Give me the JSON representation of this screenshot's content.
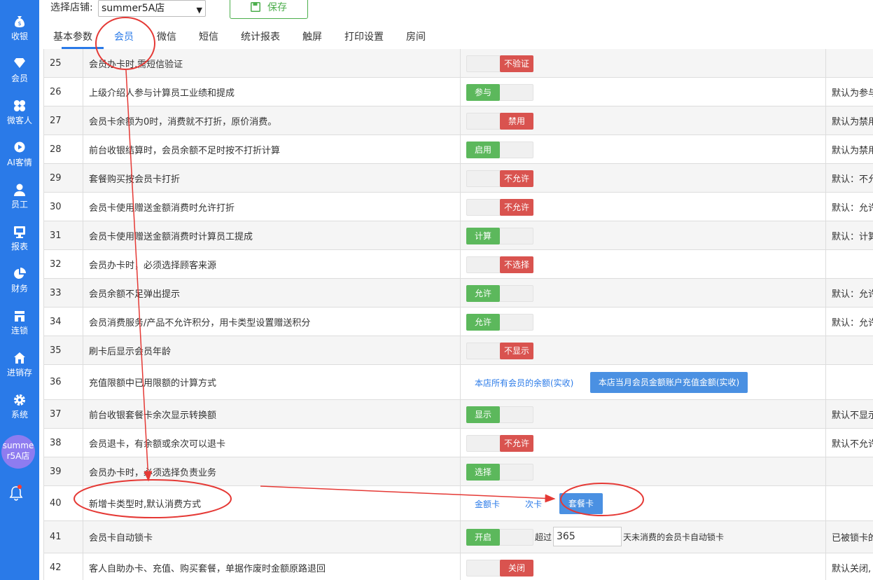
{
  "sidebar": {
    "items": [
      {
        "label": "收银",
        "icon": "money-bag-icon"
      },
      {
        "label": "会员",
        "icon": "diamond-icon"
      },
      {
        "label": "微客人",
        "icon": "clover-icon"
      },
      {
        "label": "AI客情",
        "icon": "play-circle-icon"
      },
      {
        "label": "员工",
        "icon": "user-icon"
      },
      {
        "label": "报表",
        "icon": "monitor-icon"
      },
      {
        "label": "财务",
        "icon": "pie-chart-icon"
      },
      {
        "label": "连锁",
        "icon": "store-icon"
      },
      {
        "label": "进销存",
        "icon": "home-icon"
      },
      {
        "label": "系统",
        "icon": "gear-icon"
      }
    ],
    "store_avatar": "summer5A店",
    "bell_icon": "bell-icon"
  },
  "header": {
    "store_label": "选择店铺:",
    "store_value": "summer5A店",
    "save_label": "保存",
    "tabs": [
      "基本参数",
      "会员",
      "微信",
      "短信",
      "统计报表",
      "触屏",
      "打印设置",
      "房间"
    ],
    "active_tab": "会员"
  },
  "rows": [
    {
      "num": "25",
      "desc": "会员办卡时,需短信验证",
      "type": "toggle",
      "on": false,
      "label": "不验证",
      "note": ""
    },
    {
      "num": "26",
      "desc": "上级介绍人参与计算员工业绩和提成",
      "type": "toggle",
      "on": true,
      "label": "参与",
      "note": "默认为参与"
    },
    {
      "num": "27",
      "desc": "会员卡余额为0时，消费就不打折，原价消费。",
      "type": "toggle",
      "on": false,
      "label": "禁用",
      "note": "默认为禁用"
    },
    {
      "num": "28",
      "desc": "前台收银结算时，会员余额不足时按不打折计算",
      "type": "toggle",
      "on": true,
      "label": "启用",
      "note": "默认为禁用"
    },
    {
      "num": "29",
      "desc": "套餐购买按会员卡打折",
      "type": "toggle",
      "on": false,
      "label": "不允许",
      "note": "默认：不允"
    },
    {
      "num": "30",
      "desc": "会员卡使用赠送金额消费时允许打折",
      "type": "toggle",
      "on": false,
      "label": "不允许",
      "note": "默认：允许"
    },
    {
      "num": "31",
      "desc": "会员卡使用赠送金额消费时计算员工提成",
      "type": "toggle",
      "on": true,
      "label": "计算",
      "note": "默认：计算"
    },
    {
      "num": "32",
      "desc": "会员办卡时，必须选择顾客来源",
      "type": "toggle",
      "on": false,
      "label": "不选择",
      "note": ""
    },
    {
      "num": "33",
      "desc": "会员余额不足弹出提示",
      "type": "toggle",
      "on": true,
      "label": "允许",
      "note": "默认：允许"
    },
    {
      "num": "34",
      "desc": "会员消费服务/产品不允许积分，用卡类型设置赠送积分",
      "type": "toggle",
      "on": true,
      "label": "允许",
      "note": "默认：允许"
    },
    {
      "num": "35",
      "desc": "刷卡后显示会员年龄",
      "type": "toggle",
      "on": false,
      "label": "不显示",
      "note": ""
    },
    {
      "num": "36",
      "desc": "充值限额中已用限额的计算方式",
      "type": "options",
      "options": [
        "本店所有会员的余额(实收)",
        "本店当月会员金额账户充值金额(实收)"
      ],
      "selected": 1,
      "note": ""
    },
    {
      "num": "37",
      "desc": "前台收银套餐卡余次显示转换额",
      "type": "toggle",
      "on": true,
      "label": "显示",
      "note": "默认不显示"
    },
    {
      "num": "38",
      "desc": "会员退卡，有余额或余次可以退卡",
      "type": "toggle",
      "on": false,
      "label": "不允许",
      "note": "默认不允许"
    },
    {
      "num": "39",
      "desc": "会员办卡时，必须选择负责业务",
      "type": "toggle",
      "on": true,
      "label": "选择",
      "note": ""
    },
    {
      "num": "40",
      "desc": "新增卡类型时,默认消费方式",
      "type": "options",
      "options": [
        "金额卡",
        "次卡",
        "套餐卡"
      ],
      "selected": 2,
      "note": ""
    },
    {
      "num": "41",
      "desc": "会员卡自动锁卡",
      "type": "lock",
      "on": true,
      "label": "开启",
      "prefix": "超过",
      "days": "365",
      "suffix": "天未消费的会员卡自动锁卡",
      "note": "已被锁卡的"
    },
    {
      "num": "42",
      "desc": "客人自助办卡、充值、购买套餐，单据作废时金额原路退回",
      "type": "toggle",
      "on": false,
      "label": "关闭",
      "note": "默认关闭,"
    }
  ]
}
